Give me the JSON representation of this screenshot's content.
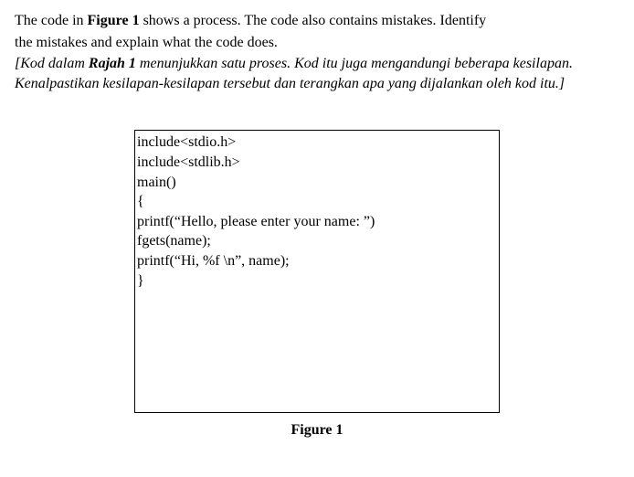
{
  "question": {
    "line1_part1": "The code in ",
    "line1_bold": "Figure 1",
    "line1_part2": " shows a process. The code also contains mistakes. Identify",
    "line2": "the mistakes and explain what the code does."
  },
  "translation": {
    "line1_part1": "[Kod dalam ",
    "line1_bold": "Rajah 1",
    "line1_part2": " menunjukkan satu proses. Kod itu juga mengandungi beberapa kesilapan.",
    "line2": "Kenalpastikan kesilapan-kesilapan tersebut dan terangkan apa yang dijalankan oleh kod itu.]"
  },
  "code": {
    "line1": "include<stdio.h>",
    "line2": "include<stdlib.h>",
    "line3": "",
    "line4": "main()",
    "line5": "{",
    "line6": "printf(“Hello, please enter your name: ”)",
    "line7": "fgets(name);",
    "line8": "",
    "line9": "printf(“Hi, %f \\n”, name);",
    "line10": "",
    "line11": "}"
  },
  "caption": "Figure 1"
}
